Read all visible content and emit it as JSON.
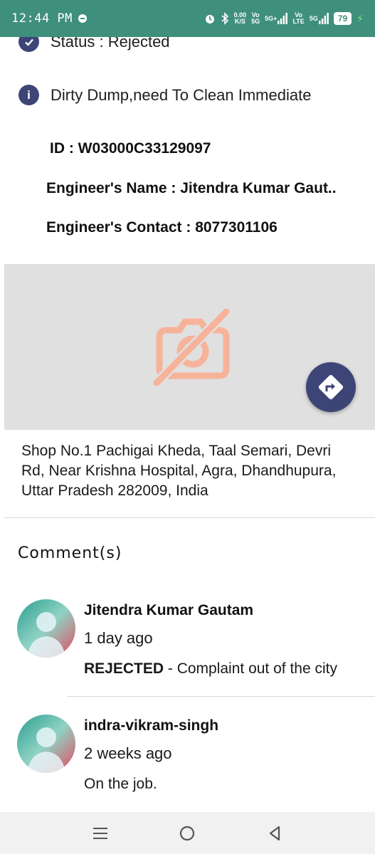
{
  "status_bar": {
    "time": "12:44 PM",
    "net_speed_value": "0.00",
    "net_speed_unit": "K/S",
    "vo1_top": "Vo",
    "vo1_bottom": "5G",
    "sig1_label": "5G+",
    "vo2_top": "Vo",
    "vo2_bottom": "LTE",
    "sig2_label": "5G",
    "battery": "79"
  },
  "details": {
    "status_text": "Status : Rejected",
    "description": "Dirty Dump,need To Clean Immediate",
    "id_line": "ID :  W03000C33129097",
    "engineer_name_line": "Engineer's Name : Jitendra Kumar Gaut..",
    "engineer_contact_line": "Engineer's Contact : 8077301106"
  },
  "address": "Shop No.1 Pachigai Kheda, Taal Semari, Devri Rd, Near Krishna Hospital, Agra, Dhandhupura, Uttar Pradesh 282009, India",
  "comments_title": "Comment(s)",
  "comments": [
    {
      "name": "Jitendra Kumar Gautam",
      "time": "1 day ago",
      "status": "REJECTED",
      "message": " - Complaint out of the city"
    },
    {
      "name": "indra-vikram-singh",
      "time": "2 weeks ago",
      "status": "",
      "message": "On the job."
    }
  ],
  "colors": {
    "status_bar": "#3f8f7d",
    "accent": "#3d4577",
    "placeholder_icon": "#f7b39a"
  }
}
